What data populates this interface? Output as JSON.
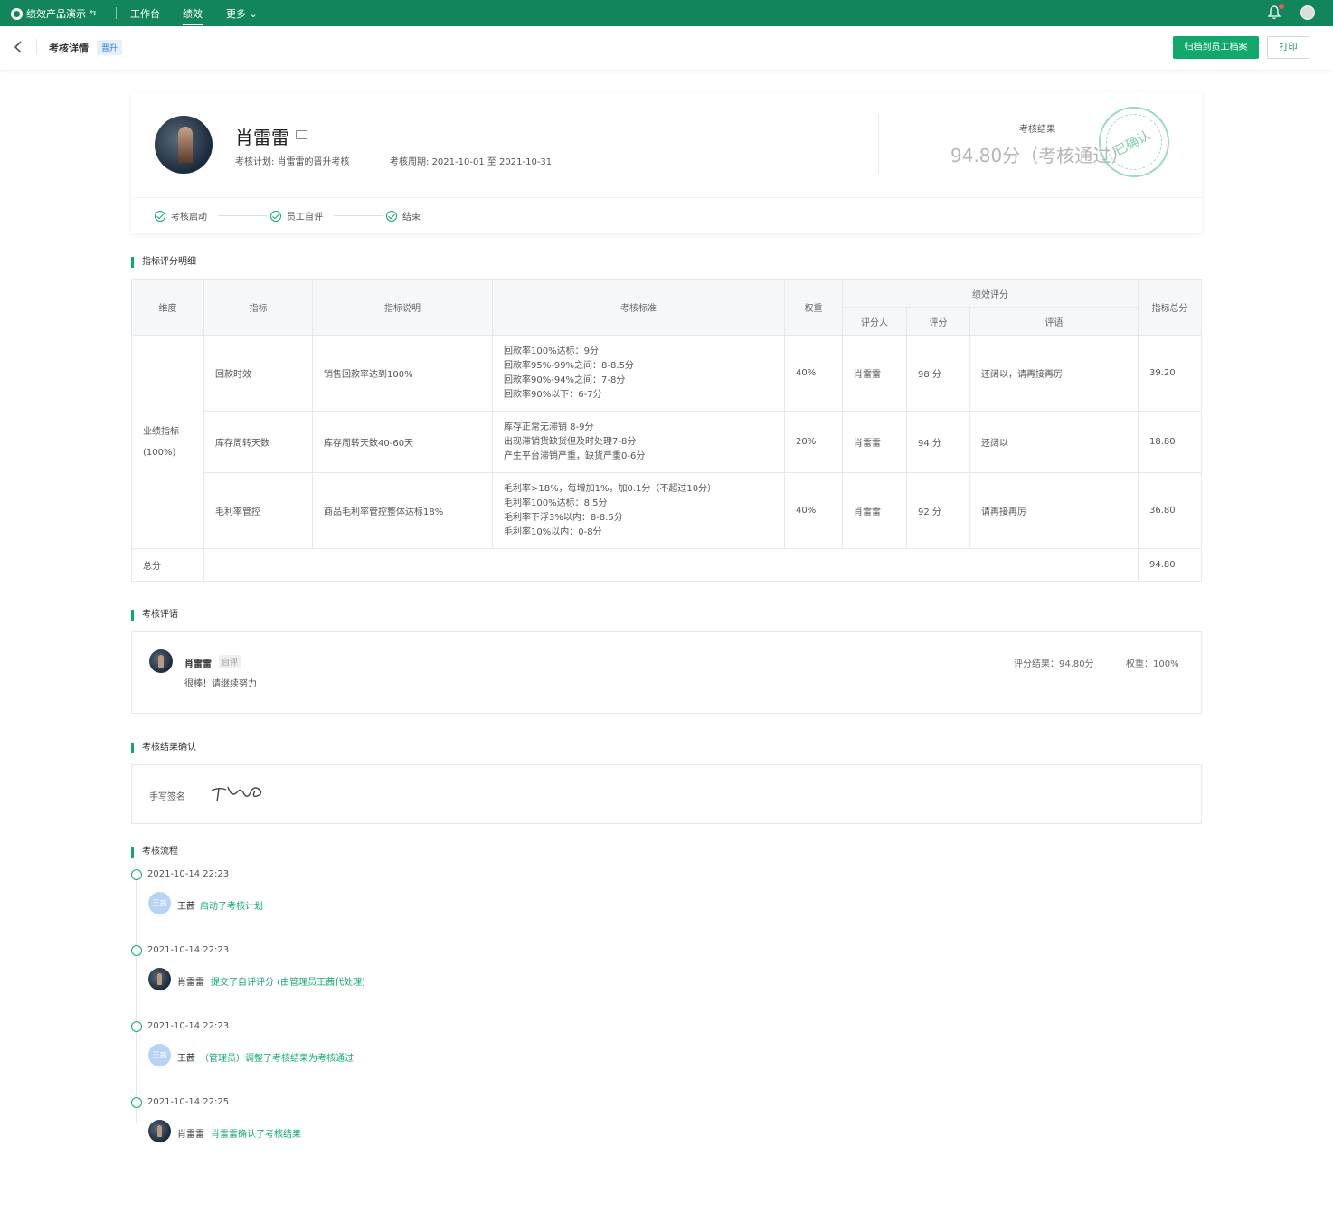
{
  "topbar": {
    "app_name": "绩效产品演示",
    "nav": [
      "工作台",
      "绩效",
      "更多"
    ],
    "colors": {
      "brand": "#12865a",
      "accent": "#12a86c"
    }
  },
  "subbar": {
    "title": "考核详情",
    "tag": "晋升",
    "archive_button": "归档到员工档案",
    "print_button": "打印"
  },
  "profile": {
    "name": "肖雷雷",
    "plan_label": "考核计划:",
    "plan_value": "肖雷雷的晋升考核",
    "period_label": "考核周期:",
    "period_value": "2021-10-01 至 2021-10-31",
    "result_label": "考核结果",
    "result_value": "94.80分（考核通过）",
    "stamp_text": "已确认",
    "steps": [
      "考核启动",
      "员工自评",
      "结束"
    ]
  },
  "sections": {
    "score_detail": "指标评分明细",
    "comments": "考核评语",
    "confirm": "考核结果确认",
    "flow": "考核流程"
  },
  "score_table": {
    "headers": {
      "dimension": "维度",
      "indicator": "指标",
      "description": "指标说明",
      "criteria": "考核标准",
      "weight": "权重",
      "perf_score": "绩效评分",
      "scorer": "评分人",
      "score": "评分",
      "remark": "评语",
      "total": "指标总分"
    },
    "dimension": "业绩指标",
    "dimension_weight": "(100%)",
    "rows": [
      {
        "indicator": "回款时效",
        "description": "销售回款率达到100%",
        "criteria": [
          "回款率100%达标：9分",
          "回款率95%-99%之间：8-8.5分",
          "回款率90%-94%之间：7-8分",
          "回款率90%以下：6-7分"
        ],
        "weight": "40%",
        "scorer": "肖雷雷",
        "score": "98 分",
        "remark": "还阔以，请再接再厉",
        "total": "39.20"
      },
      {
        "indicator": "库存周转天数",
        "description": "库存周转天数40-60天",
        "criteria": [
          "库存正常无滞销 8-9分",
          "出现滞销货缺货但及时处理7-8分",
          "产生平台滞销严重，缺货严重0-6分"
        ],
        "weight": "20%",
        "scorer": "肖雷雷",
        "score": "94 分",
        "remark": "还阔以",
        "total": "18.80"
      },
      {
        "indicator": "毛利率管控",
        "description": "商品毛利率管控整体达标18%",
        "criteria": [
          "毛利率>18%，每增加1%，加0.1分（不超过10分）",
          "毛利率100%达标：8.5分",
          "毛利率下浮3%以内：8-8.5分",
          "毛利率10%以内：0-8分"
        ],
        "weight": "40%",
        "scorer": "肖雷雷",
        "score": "92 分",
        "remark": "请再接再厉",
        "total": "36.80"
      }
    ],
    "sum_label": "总分",
    "sum_value": "94.80"
  },
  "comment": {
    "name": "肖雷雷",
    "tag": "自评",
    "text": "很棒！请继续努力",
    "result": "评分结果：94.80分",
    "weight": "权重：100%"
  },
  "confirm": {
    "label": "手写签名"
  },
  "flow": [
    {
      "time": "2021-10-14 22:23",
      "avatar": "王茜",
      "who": "王茜",
      "action": "启动了考核计划"
    },
    {
      "time": "2021-10-14 22:23",
      "avatar": "",
      "who": "肖雷雷",
      "action": "提交了自评评分 (由管理员王茜代处理)"
    },
    {
      "time": "2021-10-14 22:23",
      "avatar": "王茜",
      "who": "王茜",
      "action": "（管理员）调整了考核结果为考核通过"
    },
    {
      "time": "2021-10-14 22:25",
      "avatar": "",
      "who": "肖雷雷",
      "action": "肖雷雷确认了考核结果"
    }
  ]
}
